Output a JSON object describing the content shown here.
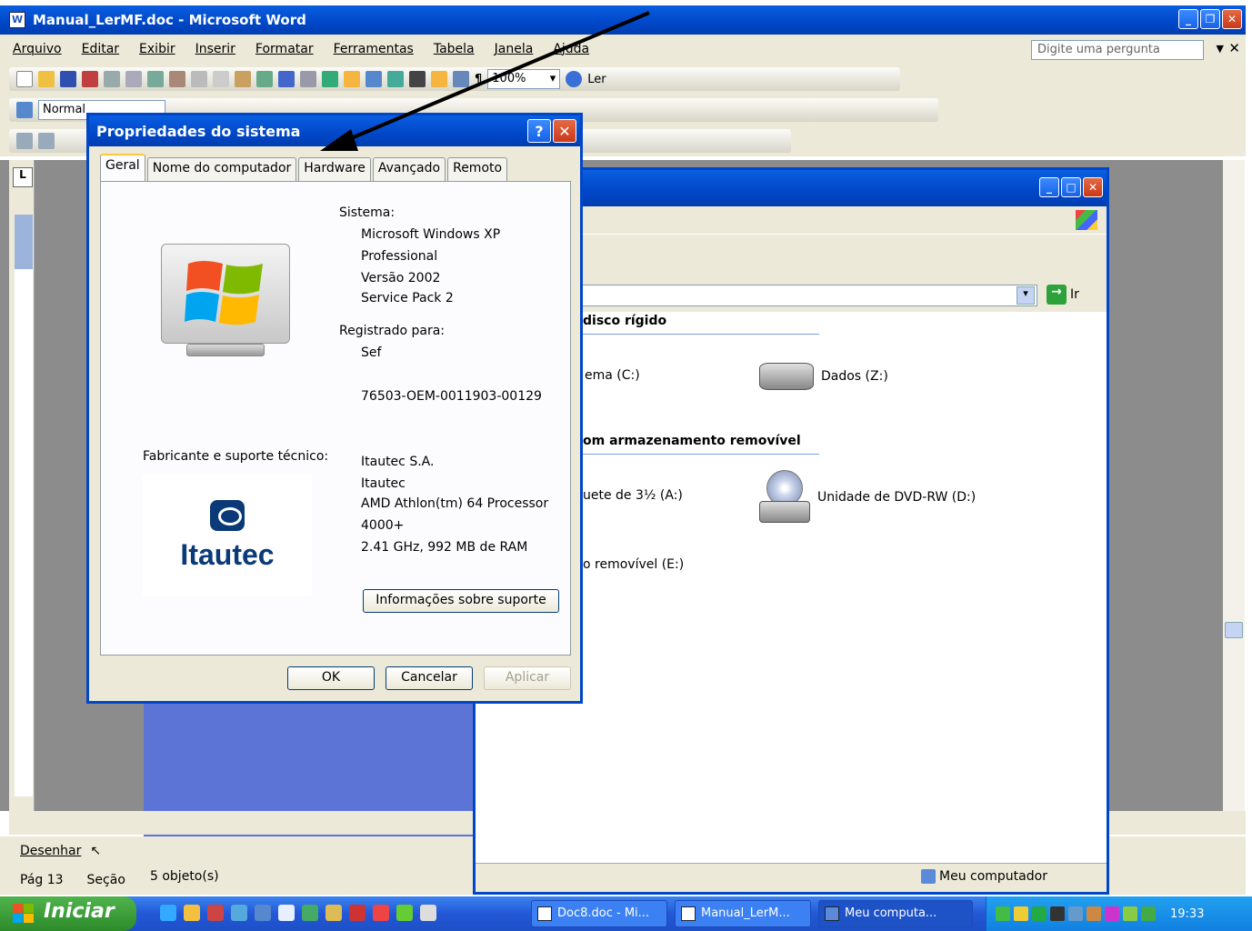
{
  "word": {
    "title": "Manual_LerMF.doc - Microsoft Word",
    "menu": [
      "Arquivo",
      "Editar",
      "Exibir",
      "Inserir",
      "Formatar",
      "Ferramentas",
      "Tabela",
      "Janela",
      "Ajuda"
    ],
    "ask_placeholder": "Digite uma pergunta",
    "zoom": "100%",
    "read_label": "Ler",
    "style_value": "Normal",
    "draw_label": "Desenhar",
    "status": {
      "page": "Pág 13",
      "section": "Seção"
    }
  },
  "explorer": {
    "go_label": "Ir",
    "hdd_section": "disco rígido",
    "removable_section": "om armazenamento removível",
    "drives": [
      {
        "label": "ema (C:)"
      },
      {
        "label": "Dados (Z:)"
      },
      {
        "label": "uete de 3½ (A:)"
      },
      {
        "label": "Unidade de DVD-RW (D:)"
      },
      {
        "label": "o removível (E:)"
      }
    ],
    "status_count": "5 objeto(s)",
    "status_location": "Meu computador"
  },
  "dialog": {
    "title": "Propriedades do sistema",
    "tabs": [
      "Geral",
      "Nome do computador",
      "Hardware",
      "Avançado",
      "Remoto"
    ],
    "system_label": "Sistema:",
    "system_lines": [
      "Microsoft Windows XP",
      "Professional",
      "Versão 2002",
      "Service Pack 2"
    ],
    "registered_label": "Registrado para:",
    "registered_user": "Sef",
    "product_id": "76503-OEM-0011903-00129",
    "manufacturer_label": "Fabricante e suporte técnico:",
    "manufacturer_lines": [
      "Itautec S.A.",
      "Itautec",
      "AMD Athlon(tm) 64 Processor",
      "4000+",
      "2.41 GHz, 992 MB de RAM"
    ],
    "logo_text": "Itautec",
    "support_button": "Informações sobre suporte",
    "ok": "OK",
    "cancel": "Cancelar",
    "apply": "Aplicar"
  },
  "taskbar": {
    "start": "Iniciar",
    "tasks": [
      "Doc8.doc - Mi...",
      "Manual_LerM...",
      "Meu computa..."
    ],
    "clock": "19:33"
  }
}
